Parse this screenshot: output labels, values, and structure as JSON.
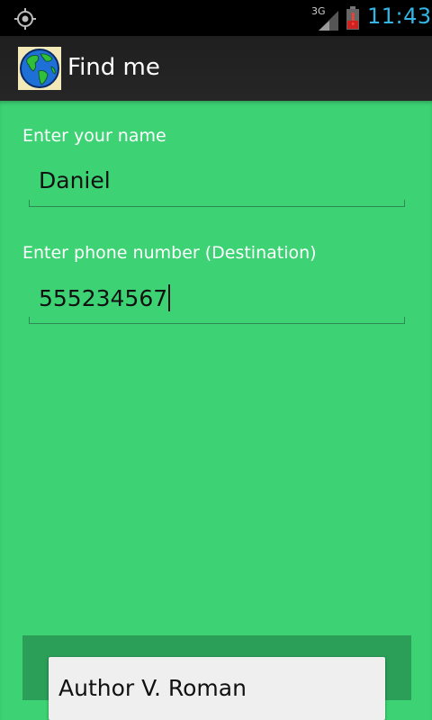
{
  "status_bar": {
    "network_type": "3G",
    "time": "11:43",
    "icons": [
      "gps-icon",
      "signal-icon",
      "battery-alert-icon"
    ],
    "clock_color": "#33b5e5"
  },
  "action_bar": {
    "title": "Find me",
    "icon": "globe-icon"
  },
  "form": {
    "name_label": "Enter your name",
    "name_value": "Daniel",
    "phone_label": "Enter phone number (Destination)",
    "phone_value": "555234567"
  },
  "footer": {
    "author_label": "Author V. Roman"
  },
  "colors": {
    "background": "#3dd374",
    "footer_panel": "#2b9e58",
    "button": "#efefef"
  }
}
